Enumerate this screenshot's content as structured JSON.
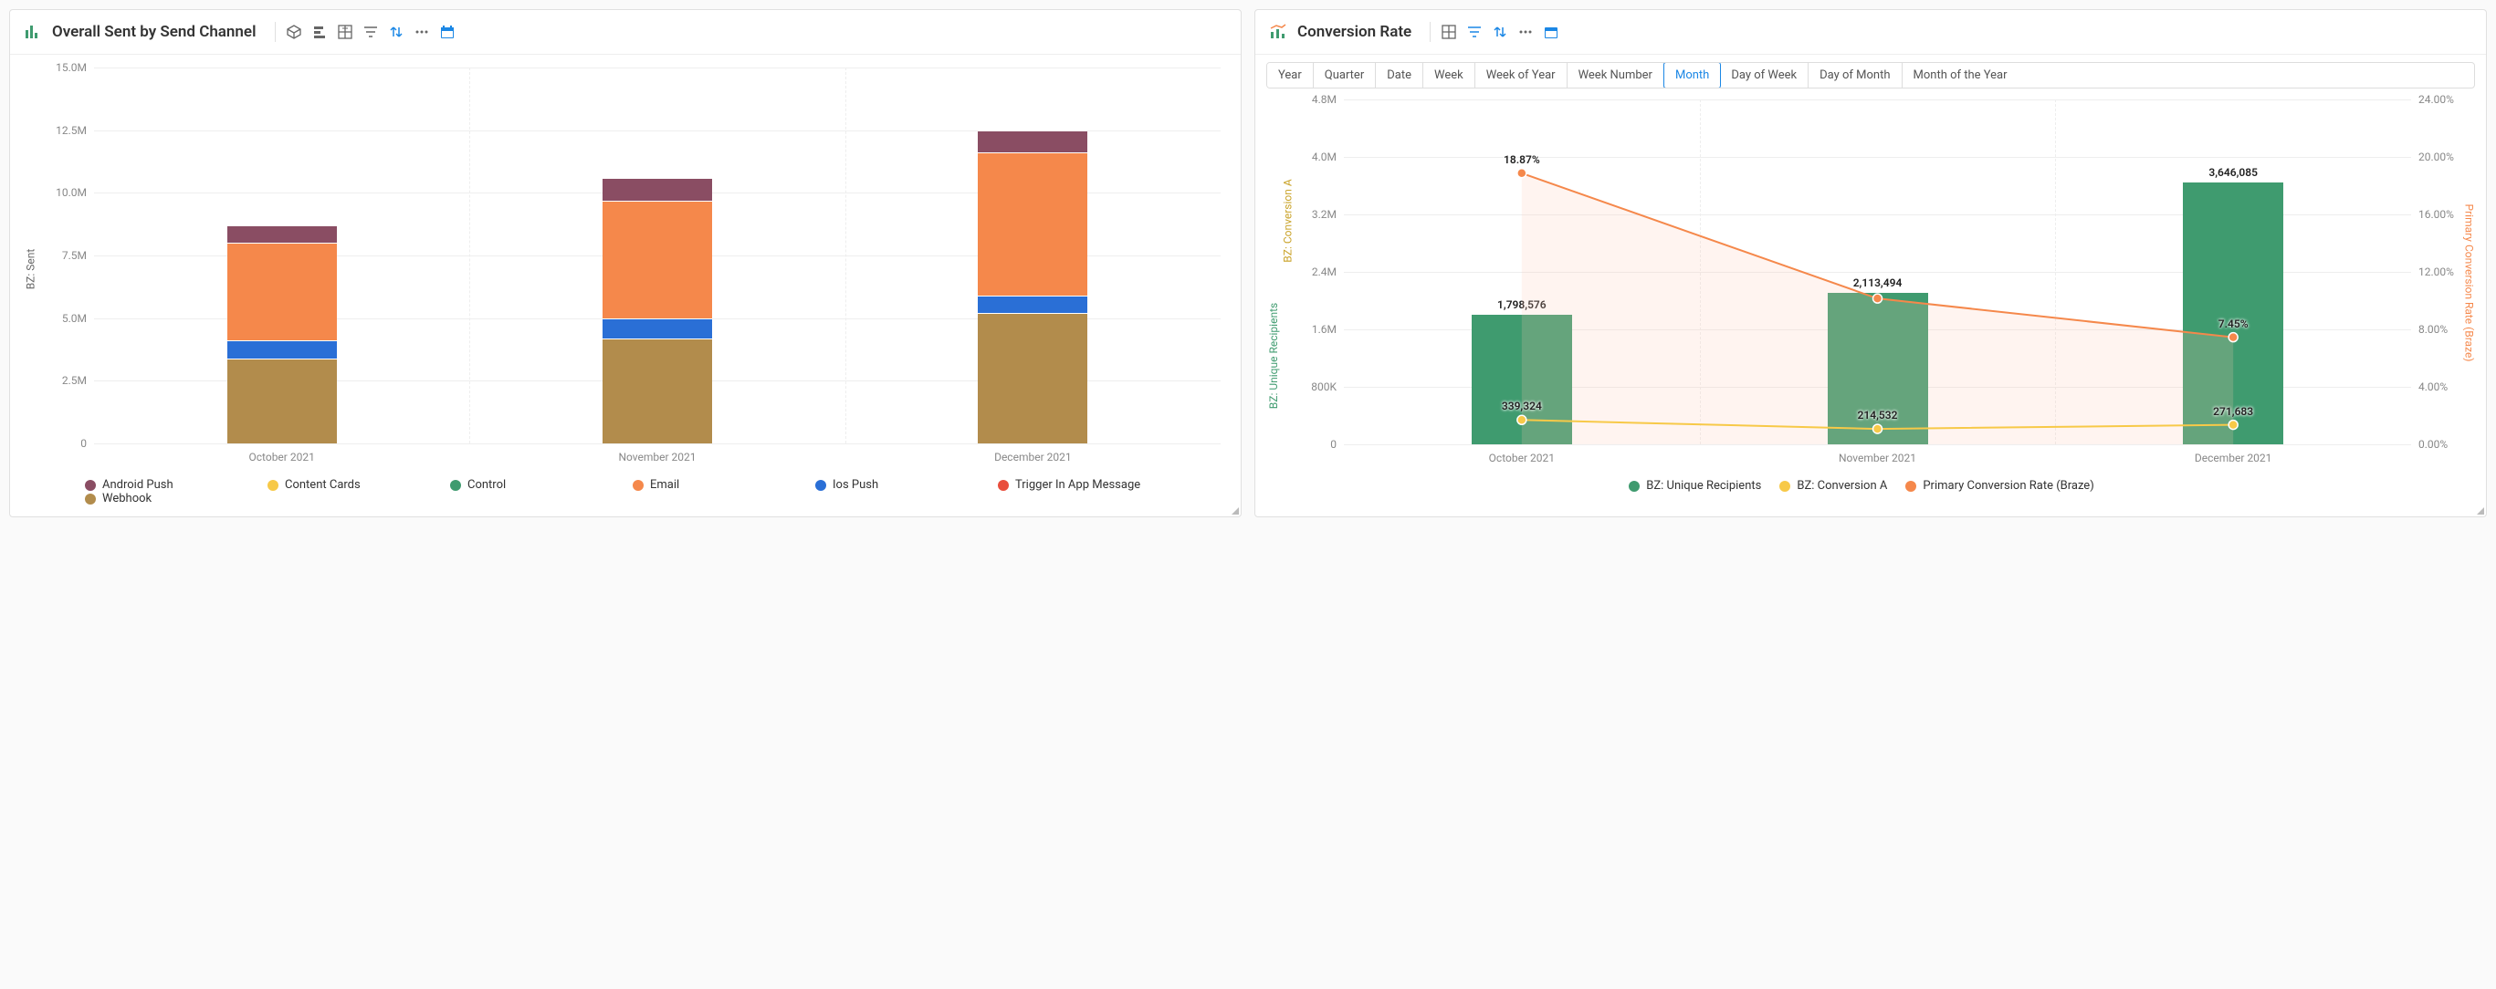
{
  "left": {
    "title": "Overall Sent by Send Channel",
    "toolbar_icons": [
      "cube",
      "h-bar",
      "tile",
      "filter",
      "sort",
      "more",
      "calendar"
    ],
    "y_axis_label": "BZ: Sent",
    "y_ticks": [
      "0",
      "2.5M",
      "5.0M",
      "7.5M",
      "10.0M",
      "12.5M",
      "15.0M"
    ],
    "categories": [
      "October 2021",
      "November 2021",
      "December 2021"
    ],
    "legend": [
      {
        "name": "Android Push",
        "color": "#8a4d63"
      },
      {
        "name": "Content Cards",
        "color": "#f7c948"
      },
      {
        "name": "Control",
        "color": "#3f9b6f"
      },
      {
        "name": "Email",
        "color": "#f5884b"
      },
      {
        "name": "Ios Push",
        "color": "#2a6fd6"
      },
      {
        "name": "Trigger In App Message",
        "color": "#e94e3d"
      },
      {
        "name": "Webhook",
        "color": "#b28c4c"
      }
    ]
  },
  "right": {
    "title": "Conversion Rate",
    "toolbar_icons": [
      "tile",
      "filter",
      "sort",
      "more",
      "calendar"
    ],
    "time_grains": [
      "Year",
      "Quarter",
      "Date",
      "Week",
      "Week of Year",
      "Week Number",
      "Month",
      "Day of Week",
      "Day of Month",
      "Month of the Year"
    ],
    "active_grain": "Month",
    "y_axis_label_a": "BZ: Unique Recipients",
    "y_axis_label_b": "BZ: Conversion A",
    "y2_axis_label": "Primary Conversion Rate (Braze)",
    "y_ticks": [
      "0",
      "800K",
      "1.6M",
      "2.4M",
      "3.2M",
      "4.0M",
      "4.8M"
    ],
    "y2_ticks": [
      "0.00%",
      "4.00%",
      "8.00%",
      "12.00%",
      "16.00%",
      "20.00%",
      "24.00%"
    ],
    "categories": [
      "October 2021",
      "November 2021",
      "December 2021"
    ],
    "bar_labels": [
      "1,798,576",
      "2,113,494",
      "3,646,085"
    ],
    "conv_labels": [
      "339,324",
      "214,532",
      "271,683"
    ],
    "rate_labels": [
      "18.87%",
      "",
      "7.45%"
    ],
    "rate_label_mid": "",
    "legend": [
      {
        "name": "BZ: Unique Recipients",
        "color": "#3f9b6f"
      },
      {
        "name": "BZ: Conversion A",
        "color": "#f7c948"
      },
      {
        "name": "Primary Conversion Rate (Braze)",
        "color": "#f5884b"
      }
    ]
  },
  "chart_data": [
    {
      "id": "overall_sent_by_send_channel",
      "type": "bar",
      "stacked": true,
      "title": "Overall Sent by Send Channel",
      "xlabel": "",
      "ylabel": "BZ: Sent",
      "ylim": [
        0,
        15000000
      ],
      "categories": [
        "October 2021",
        "November 2021",
        "December 2021"
      ],
      "series": [
        {
          "name": "Webhook",
          "color": "#b28c4c",
          "values": [
            3400000,
            4200000,
            5200000
          ]
        },
        {
          "name": "Ios Push",
          "color": "#2a6fd6",
          "values": [
            700000,
            800000,
            700000
          ]
        },
        {
          "name": "Email",
          "color": "#f5884b",
          "values": [
            3900000,
            4700000,
            5700000
          ]
        },
        {
          "name": "Android Push",
          "color": "#8a4d63",
          "values": [
            700000,
            900000,
            900000
          ]
        },
        {
          "name": "Content Cards",
          "color": "#f7c948",
          "values": [
            0,
            0,
            0
          ]
        },
        {
          "name": "Control",
          "color": "#3f9b6f",
          "values": [
            0,
            0,
            0
          ]
        },
        {
          "name": "Trigger In App Message",
          "color": "#e94e3d",
          "values": [
            0,
            0,
            0
          ]
        }
      ]
    },
    {
      "id": "conversion_rate",
      "type": "combo",
      "title": "Conversion Rate",
      "categories": [
        "October 2021",
        "November 2021",
        "December 2021"
      ],
      "y_left": {
        "label": "BZ: Unique Recipients / BZ: Conversion A",
        "lim": [
          0,
          4800000
        ]
      },
      "y_right": {
        "label": "Primary Conversion Rate (Braze)",
        "lim": [
          0,
          24
        ],
        "unit": "%"
      },
      "series": [
        {
          "name": "BZ: Unique Recipients",
          "axis": "left",
          "type": "bar",
          "color": "#3f9b6f",
          "values": [
            1798576,
            2113494,
            3646085
          ]
        },
        {
          "name": "BZ: Conversion A",
          "axis": "left",
          "type": "line",
          "color": "#f7c948",
          "values": [
            339324,
            214532,
            271683
          ]
        },
        {
          "name": "Primary Conversion Rate (Braze)",
          "axis": "right",
          "type": "line",
          "color": "#f5884b",
          "values": [
            18.87,
            10.15,
            7.45
          ]
        }
      ]
    }
  ]
}
